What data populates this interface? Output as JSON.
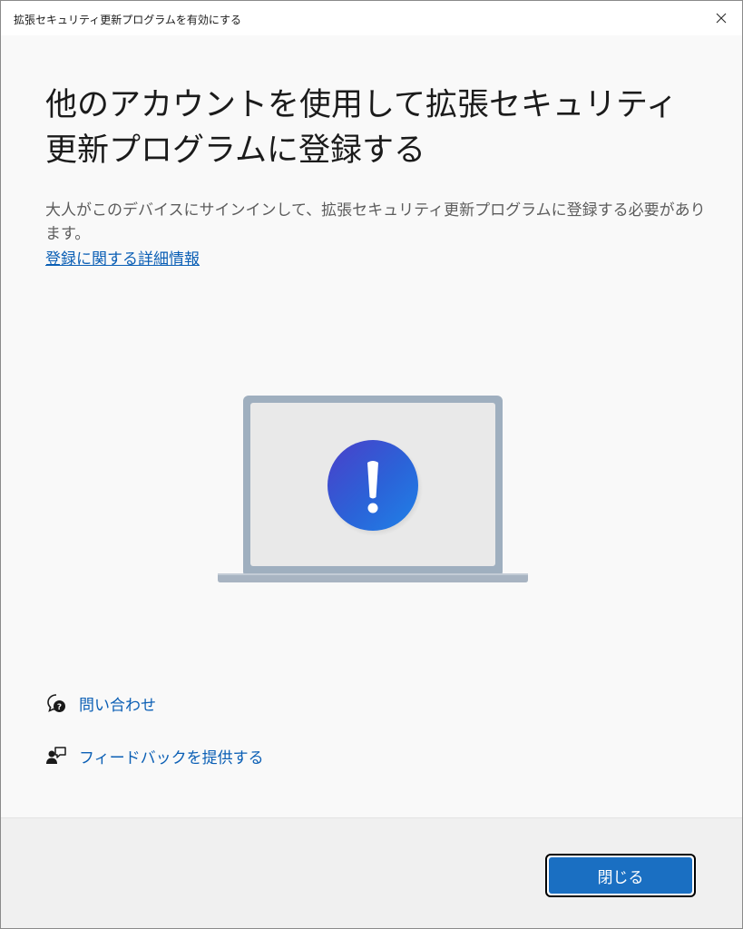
{
  "window": {
    "title": "拡張セキュリティ更新プログラムを有効にする"
  },
  "main": {
    "heading": "他のアカウントを使用して拡張セキュリティ更新プログラムに登録する",
    "description": "大人がこのデバイスにサインインして、拡張セキュリティ更新プログラムに登録する必要があります。",
    "learn_more_link": "登録に関する詳細情報"
  },
  "illustration": {
    "subject": "laptop-with-warning",
    "icon": "exclamation-icon",
    "accent_color": "#1f6fd6"
  },
  "help_links": [
    {
      "label": "問い合わせ",
      "icon": "contact-support-icon"
    },
    {
      "label": "フィードバックを提供する",
      "icon": "feedback-icon"
    }
  ],
  "footer": {
    "close_label": "閉じる"
  },
  "colors": {
    "link": "#0b5fb5",
    "button_bg": "#1a6fc2",
    "background": "#f9f9f9"
  }
}
